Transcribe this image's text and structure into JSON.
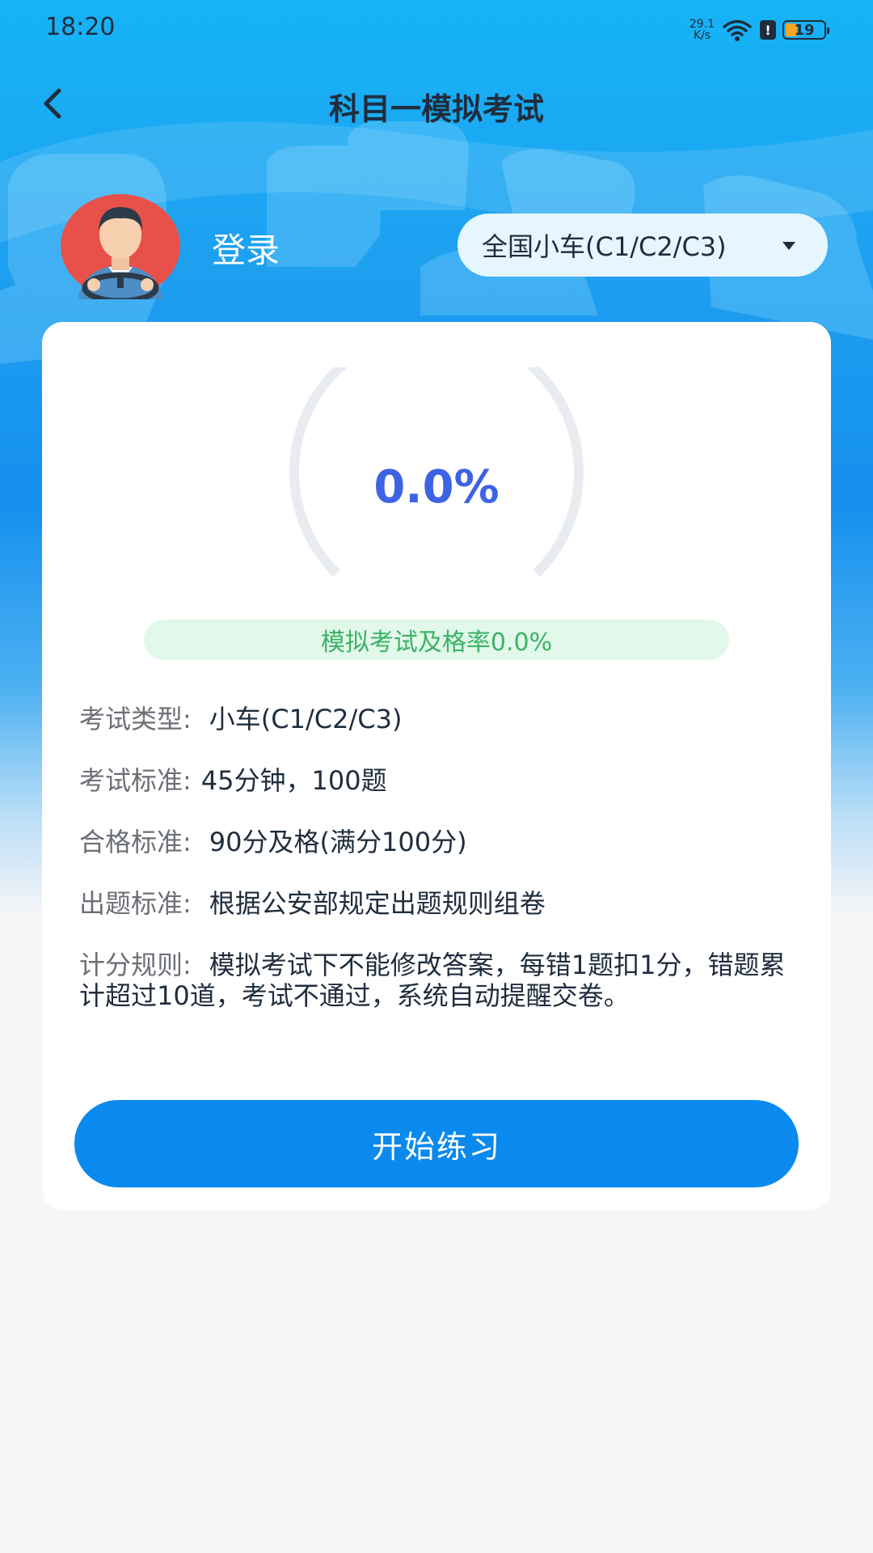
{
  "status_bar": {
    "time": "18:20",
    "net_speed_value": "29.1",
    "net_speed_unit": "K/s",
    "battery_level": "19",
    "battery_color": "#f5a623"
  },
  "header": {
    "title": "科目一模拟考试",
    "back_icon": "chevron-left-icon"
  },
  "user": {
    "login_label": "登录",
    "avatar_icon": "driver-avatar-icon"
  },
  "license_selector": {
    "value": "全国小车(C1/C2/C3)",
    "icon": "caret-down-icon"
  },
  "score": {
    "value_text": "0.0%",
    "pass_rate_text": "模拟考试及格率0.0%",
    "progress_fraction": 0.0,
    "accent_color": "#3d63e4",
    "pass_color": "#3bb366"
  },
  "exam_info": [
    {
      "key": "考试类型:",
      "value": "小车(C1/C2/C3)"
    },
    {
      "key": "考试标准:",
      "value": "45分钟，100题"
    },
    {
      "key": "合格标准:",
      "value": "90分及格(满分100分)"
    },
    {
      "key": "出题标准:",
      "value": "根据公安部规定出题规则组卷"
    },
    {
      "key": "计分规则:",
      "value": "模拟考试下不能修改答案，每错1题扣1分，错题累计超过10道，考试不通过，系统自动提醒交卷。"
    }
  ],
  "actions": {
    "start_label": "开始练习",
    "button_color": "#0a8aee"
  }
}
